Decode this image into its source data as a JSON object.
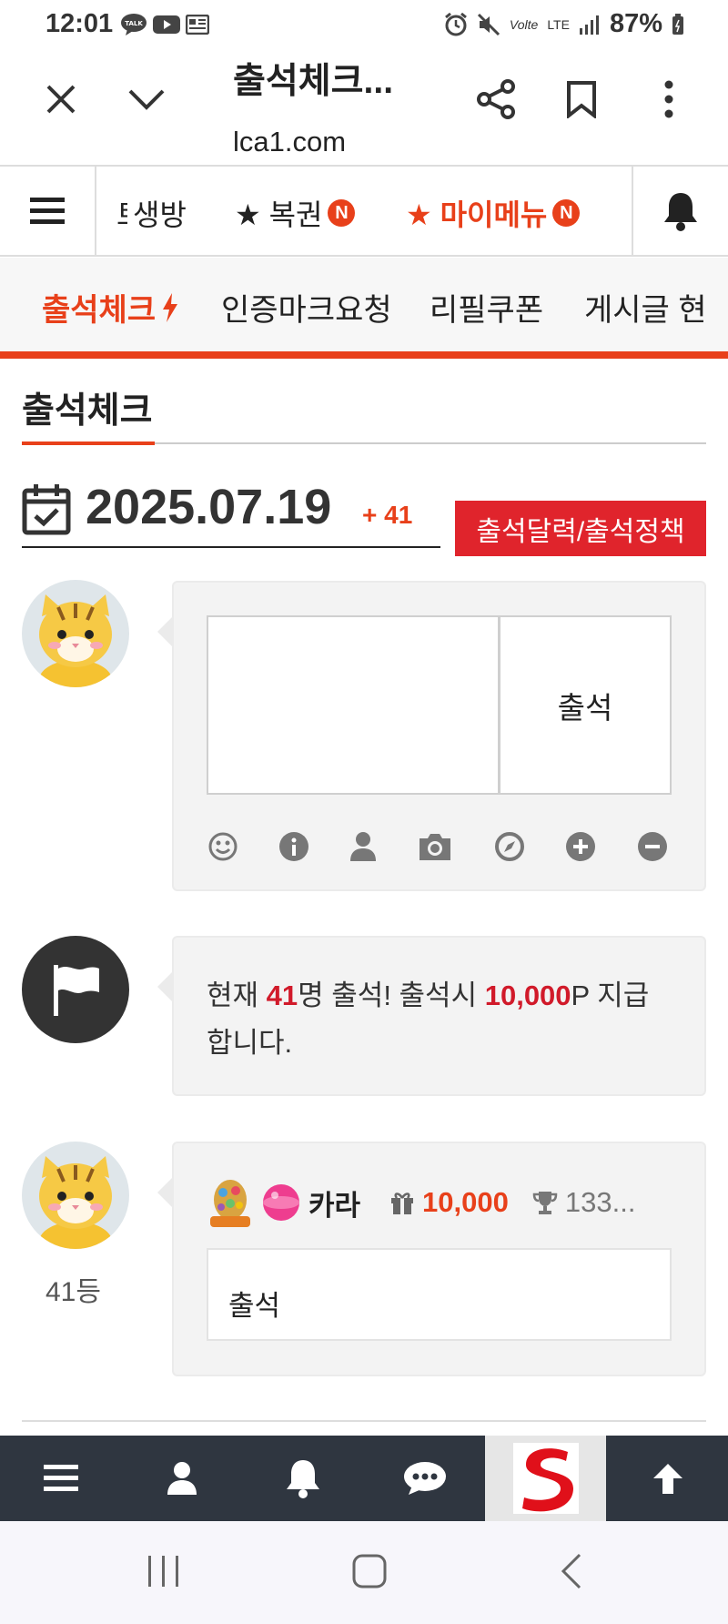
{
  "status": {
    "time": "12:01",
    "lte": "LTE",
    "battery": "87%",
    "volte": "Vo",
    "lte_sub": "lte"
  },
  "browser": {
    "title": "출석체크...",
    "url": "lca1.com"
  },
  "nav": {
    "items": [
      {
        "label": "생방"
      },
      {
        "label": "★ 복권",
        "badge": "N"
      },
      {
        "label": "★ 마이메뉴",
        "badge": "N",
        "accent": "#e8401a"
      }
    ],
    "partial_prefix": "트"
  },
  "tabs": [
    {
      "label": "출석체크"
    },
    {
      "label": "인증마크요청"
    },
    {
      "label": "리필쿠폰"
    },
    {
      "label": "게시글 현"
    }
  ],
  "page": {
    "title": "출석체크",
    "date": "2025.07.19",
    "date_delta": "+ 41",
    "calendar_button": "출석달력/출석정책"
  },
  "form": {
    "submit_label": "출석",
    "textarea_value": "",
    "tools": [
      "smile-icon",
      "info-icon",
      "user-icon",
      "camera-icon",
      "compass-icon",
      "plus-icon",
      "minus-icon"
    ]
  },
  "notice": {
    "prefix": "현재 ",
    "count": "41",
    "mid": "명 출석! 출석시 ",
    "points": "10,000",
    "suffix": "P 지급",
    "line2": "합니다."
  },
  "entry": {
    "rank": "41등",
    "username": "카라",
    "points": "10,000",
    "trophy": "133...",
    "message": "출석"
  },
  "colors": {
    "accent": "#e8401a",
    "red": "#e0242c",
    "bottombar": "#2f3640"
  }
}
